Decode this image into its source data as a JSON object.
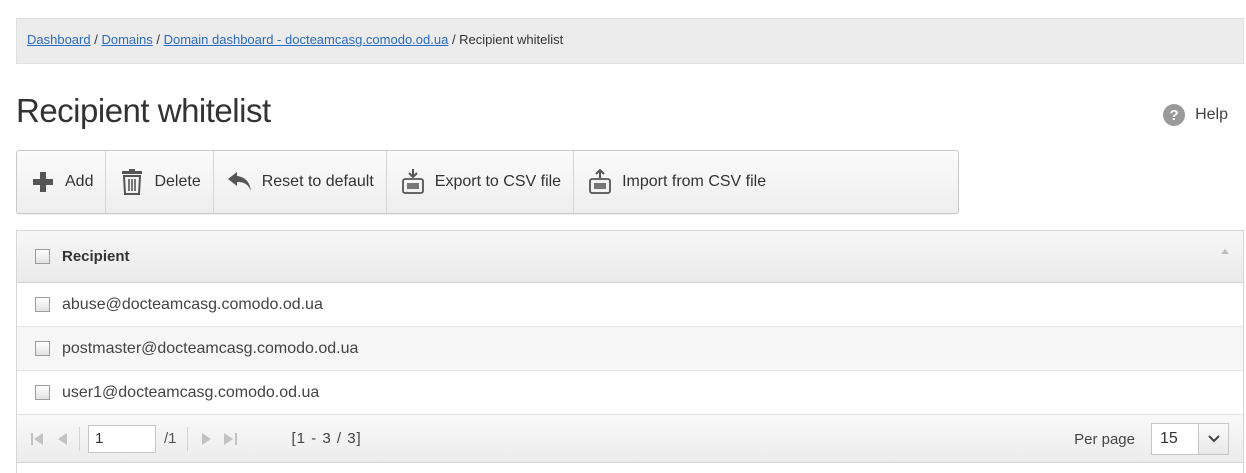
{
  "breadcrumb": {
    "items": [
      {
        "label": "Dashboard"
      },
      {
        "label": "Domains"
      },
      {
        "label": "Domain dashboard - docteamcasg.comodo.od.ua"
      }
    ],
    "current": "Recipient whitelist",
    "separator": " / "
  },
  "page": {
    "title": "Recipient whitelist",
    "help_label": "Help",
    "help_icon": "question-circle-icon"
  },
  "toolbar": {
    "buttons": [
      {
        "label": "Add",
        "icon": "plus-icon"
      },
      {
        "label": "Delete",
        "icon": "trash-icon"
      },
      {
        "label": "Reset to default",
        "icon": "reset-arrow-icon"
      },
      {
        "label": "Export to CSV file",
        "icon": "csv-export-icon"
      },
      {
        "label": "Import from CSV file",
        "icon": "csv-import-icon"
      }
    ]
  },
  "grid": {
    "column_header": "Recipient",
    "rows": [
      {
        "recipient": "abuse@docteamcasg.comodo.od.ua"
      },
      {
        "recipient": "postmaster@docteamcasg.comodo.od.ua"
      },
      {
        "recipient": "user1@docteamcasg.comodo.od.ua"
      }
    ]
  },
  "pager": {
    "current_page": "1",
    "total_pages": "/1",
    "range": "[1 - 3 / 3]",
    "per_page_label": "Per page",
    "per_page_value": "15"
  },
  "colors": {
    "link": "#2a6bc4",
    "plus_icon": "#555555",
    "breadcrumb_bg": "#ececec"
  }
}
